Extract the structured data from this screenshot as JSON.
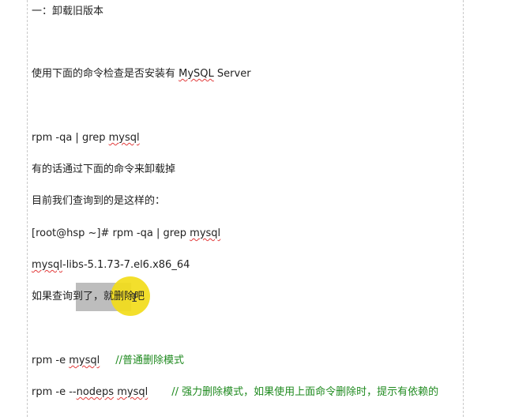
{
  "doc": {
    "heading": "一：卸载旧版本",
    "line_check_prefix": "使用下面的命令检查是否安装有 ",
    "line_check_product": "MySQL",
    "line_check_suffix": " Server",
    "cmd_query_a": "rpm -qa | grep ",
    "cmd_query_b": "mysql",
    "line_uninstall": "有的话通过下面的命令来卸载掉",
    "line_result_intro": "目前我们查询到的是这样的：",
    "prompt_a": "[root@hsp ~]# rpm -qa | grep ",
    "prompt_b": "mysql",
    "pkg_a": "mysql",
    "pkg_b": "-libs-5.1.73-7.el6.x86_64",
    "line_if_found": "如果查询到了，就删除吧",
    "cmd_remove_a": "rpm -e ",
    "cmd_remove_b": "mysql",
    "cmd_remove_comment": "//普通删除模式",
    "cmd_force_a": "rpm -e --",
    "cmd_force_b": "nodeps",
    "cmd_force_c": " ",
    "cmd_force_d": "mysql",
    "cmd_force_comment": "// 强力删除模式，如果使用上面命令删除时，提示有依赖的"
  },
  "colors": {
    "comment": "#1f8a1f",
    "selection": "#bdbdbd",
    "cursor_highlight": "#f2dc1a",
    "spellcheck": "#e23b3b"
  },
  "icons": {
    "cursor": "text-cursor-icon"
  }
}
